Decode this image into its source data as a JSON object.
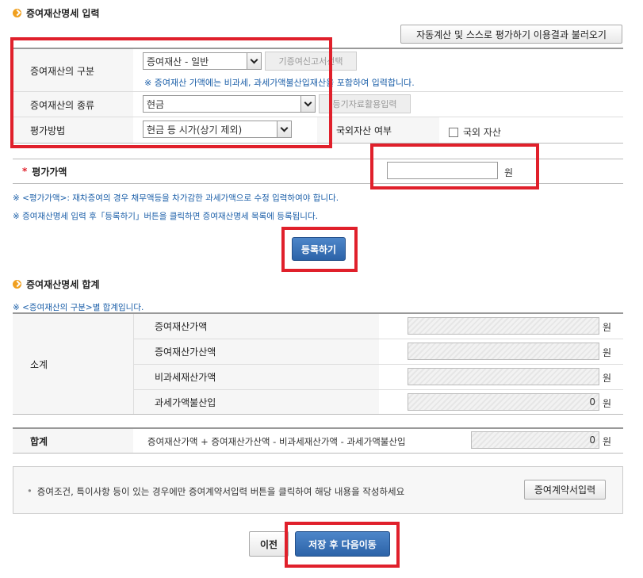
{
  "section1": {
    "title": "증여재산명세 입력",
    "load_button": "자동계산 및 스스로 평가하기 이용결과 불러오기",
    "category": {
      "label": "증여재산의 구분",
      "selected": "증여재산 - 일반",
      "side_button": "기증여신고서선택",
      "note": "※ 증여재산 가액에는 비과세, 과세가액불산입재산을 포함하여 입력합니다."
    },
    "type": {
      "label": "증여재산의 종류",
      "selected": "현금",
      "side_button": "등기자료활용입력"
    },
    "method": {
      "label": "평가방법",
      "selected": "현금 등 시가(상기 제외)"
    },
    "foreign": {
      "label": "국외자산 여부",
      "checkbox_label": "국외 자산"
    },
    "amount": {
      "required_mark": "*",
      "label": "평가가액",
      "value": "",
      "unit": "원"
    },
    "note1": "※ <평가가액>: 재차증여의 경우 채무액등을 차가감한 과세가액으로 수정 입력하여야 합니다.",
    "note2": "※ 증여재산명세 입력 후「등록하기」버튼을 클릭하면 증여재산명세 목록에 등록됩니다.",
    "register_button": "등록하기"
  },
  "section2": {
    "title": "증여재산명세 합계",
    "note": "※ <증여재산의 구분>별 합계입니다.",
    "subtotal_label": "소계",
    "rows": [
      {
        "label": "증여재산가액",
        "value": "",
        "unit": "원"
      },
      {
        "label": "증여재산가산액",
        "value": "",
        "unit": "원"
      },
      {
        "label": "비과세재산가액",
        "value": "",
        "unit": "원"
      },
      {
        "label": "과세가액불산입",
        "value": "0",
        "unit": "원"
      }
    ],
    "total": {
      "label": "합계",
      "formula": "증여재산가액 + 증여재산가산액 - 비과세재산가액 - 과세가액불산입",
      "value": "0",
      "unit": "원"
    }
  },
  "contract": {
    "text": "증여조건, 특이사항 등이 있는 경우에만 증여계약서입력 버튼을 클릭하여 해당 내용을 작성하세요",
    "button": "증여계약서입력"
  },
  "footer": {
    "prev_button": "이전",
    "next_button": "저장 후 다음이동"
  },
  "colors": {
    "highlight": "#e0202b",
    "primary_button": "#2c63a8",
    "note_text": "#1a5ea8"
  }
}
